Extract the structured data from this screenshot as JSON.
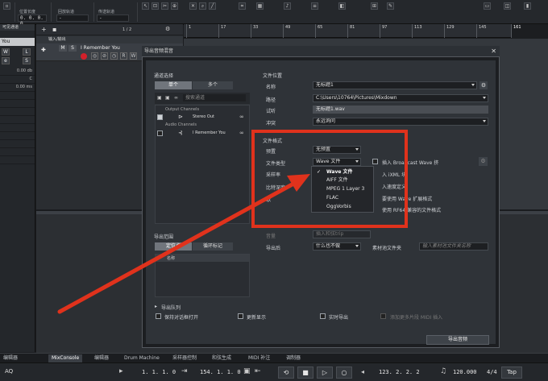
{
  "toolbar": {
    "fields": [
      {
        "label": "位置长度",
        "value": "0. 0. 0. 0"
      },
      {
        "label": "回放轨道",
        "value": "-"
      },
      {
        "label": "传送轨道",
        "value": "-"
      }
    ]
  },
  "left_panel": {
    "title": "可见通道",
    "track": "You",
    "rows": [
      "0.00 db",
      "C",
      "0.00 ms"
    ]
  },
  "tracks": {
    "counter": "1 / 2",
    "folder": "输入/输出",
    "track_name": "I Remember You",
    "buttons": [
      "M",
      "S",
      "R",
      "W"
    ]
  },
  "ruler": {
    "bars": [
      "1",
      "17",
      "33",
      "49",
      "65",
      "81",
      "97",
      "113",
      "129",
      "145",
      "161"
    ]
  },
  "dialog": {
    "title": "导出音频混音",
    "channel_select": {
      "heading": "通道选择",
      "tab_single": "单个",
      "tab_multi": "多个",
      "search_placeholder": "搜索通道",
      "tree": [
        {
          "text": "Output Channels",
          "kind": "group"
        },
        {
          "text": "Stereo Out",
          "kind": "item",
          "checked": true
        },
        {
          "text": "Audio Channels",
          "kind": "group"
        },
        {
          "text": "I Remember You",
          "kind": "item",
          "checked": false
        }
      ]
    },
    "file_location": {
      "heading": "文件位置",
      "name_label": "名称",
      "name_value": "无标题1",
      "path_label": "路径",
      "path_value": "C:\\Users\\10764\\Pictures\\Mixdown",
      "preview_label": "试听",
      "preview_value": "无标题1.wav",
      "conflict_label": "冲突",
      "conflict_value": "永远询问"
    },
    "file_format": {
      "heading": "文件格式",
      "preset_label": "预置",
      "preset_value": "无预置",
      "type_label": "文件类型",
      "type_value": "Wave 文件",
      "insert_bwf": "插入 Broadcast Wave 挤",
      "sample_rate_label": "采样率",
      "bit_depth_label": "比特深度",
      "row4_label": "歌",
      "insert_ixml": "入 iXML 块",
      "insert_tempo": "入速度定义",
      "wave_ext": "要使用 Wave 扩展格式",
      "rf64": "使用 RF64 兼容的文件格式",
      "type_options": [
        "Wave 文件",
        "AIFF 文件",
        "MPEG 1 Layer 3",
        "FLAC",
        "OggVorbis"
      ]
    },
    "export_range": {
      "heading": "导出范围",
      "tab_locator": "定位点",
      "tab_cycle": "循环标记",
      "col_name": "名称"
    },
    "post": {
      "faded_label": "音量",
      "faded_value": "插入和弦trip",
      "after_label": "导出后",
      "after_value": "什么也不做",
      "pool_label": "素材池文件夹",
      "pool_placeholder": "输入素材池文件夹名称"
    },
    "queue": {
      "heading": "导出队列",
      "keep_open": "保持对话框打开",
      "update_display": "更新显示",
      "realtime": "实时导出",
      "midi_note": "添加更多片段 MIDI 插入",
      "export_button": "导出音频"
    }
  },
  "bottom_tabs": [
    "编辑器",
    "MixConsole",
    "编辑器",
    "Drum Machine",
    "采样器控制",
    "和弦生成",
    "MIDI 补注",
    "调制器"
  ],
  "transport": {
    "left_pos": "1. 1. 1. 0",
    "right_pos": "154. 1. 1. 0",
    "position": "123. 2. 2. 2",
    "tempo": "120.000",
    "signature": "4/4",
    "tap": "Tap"
  },
  "annotation": {
    "color": "#e0321c"
  }
}
